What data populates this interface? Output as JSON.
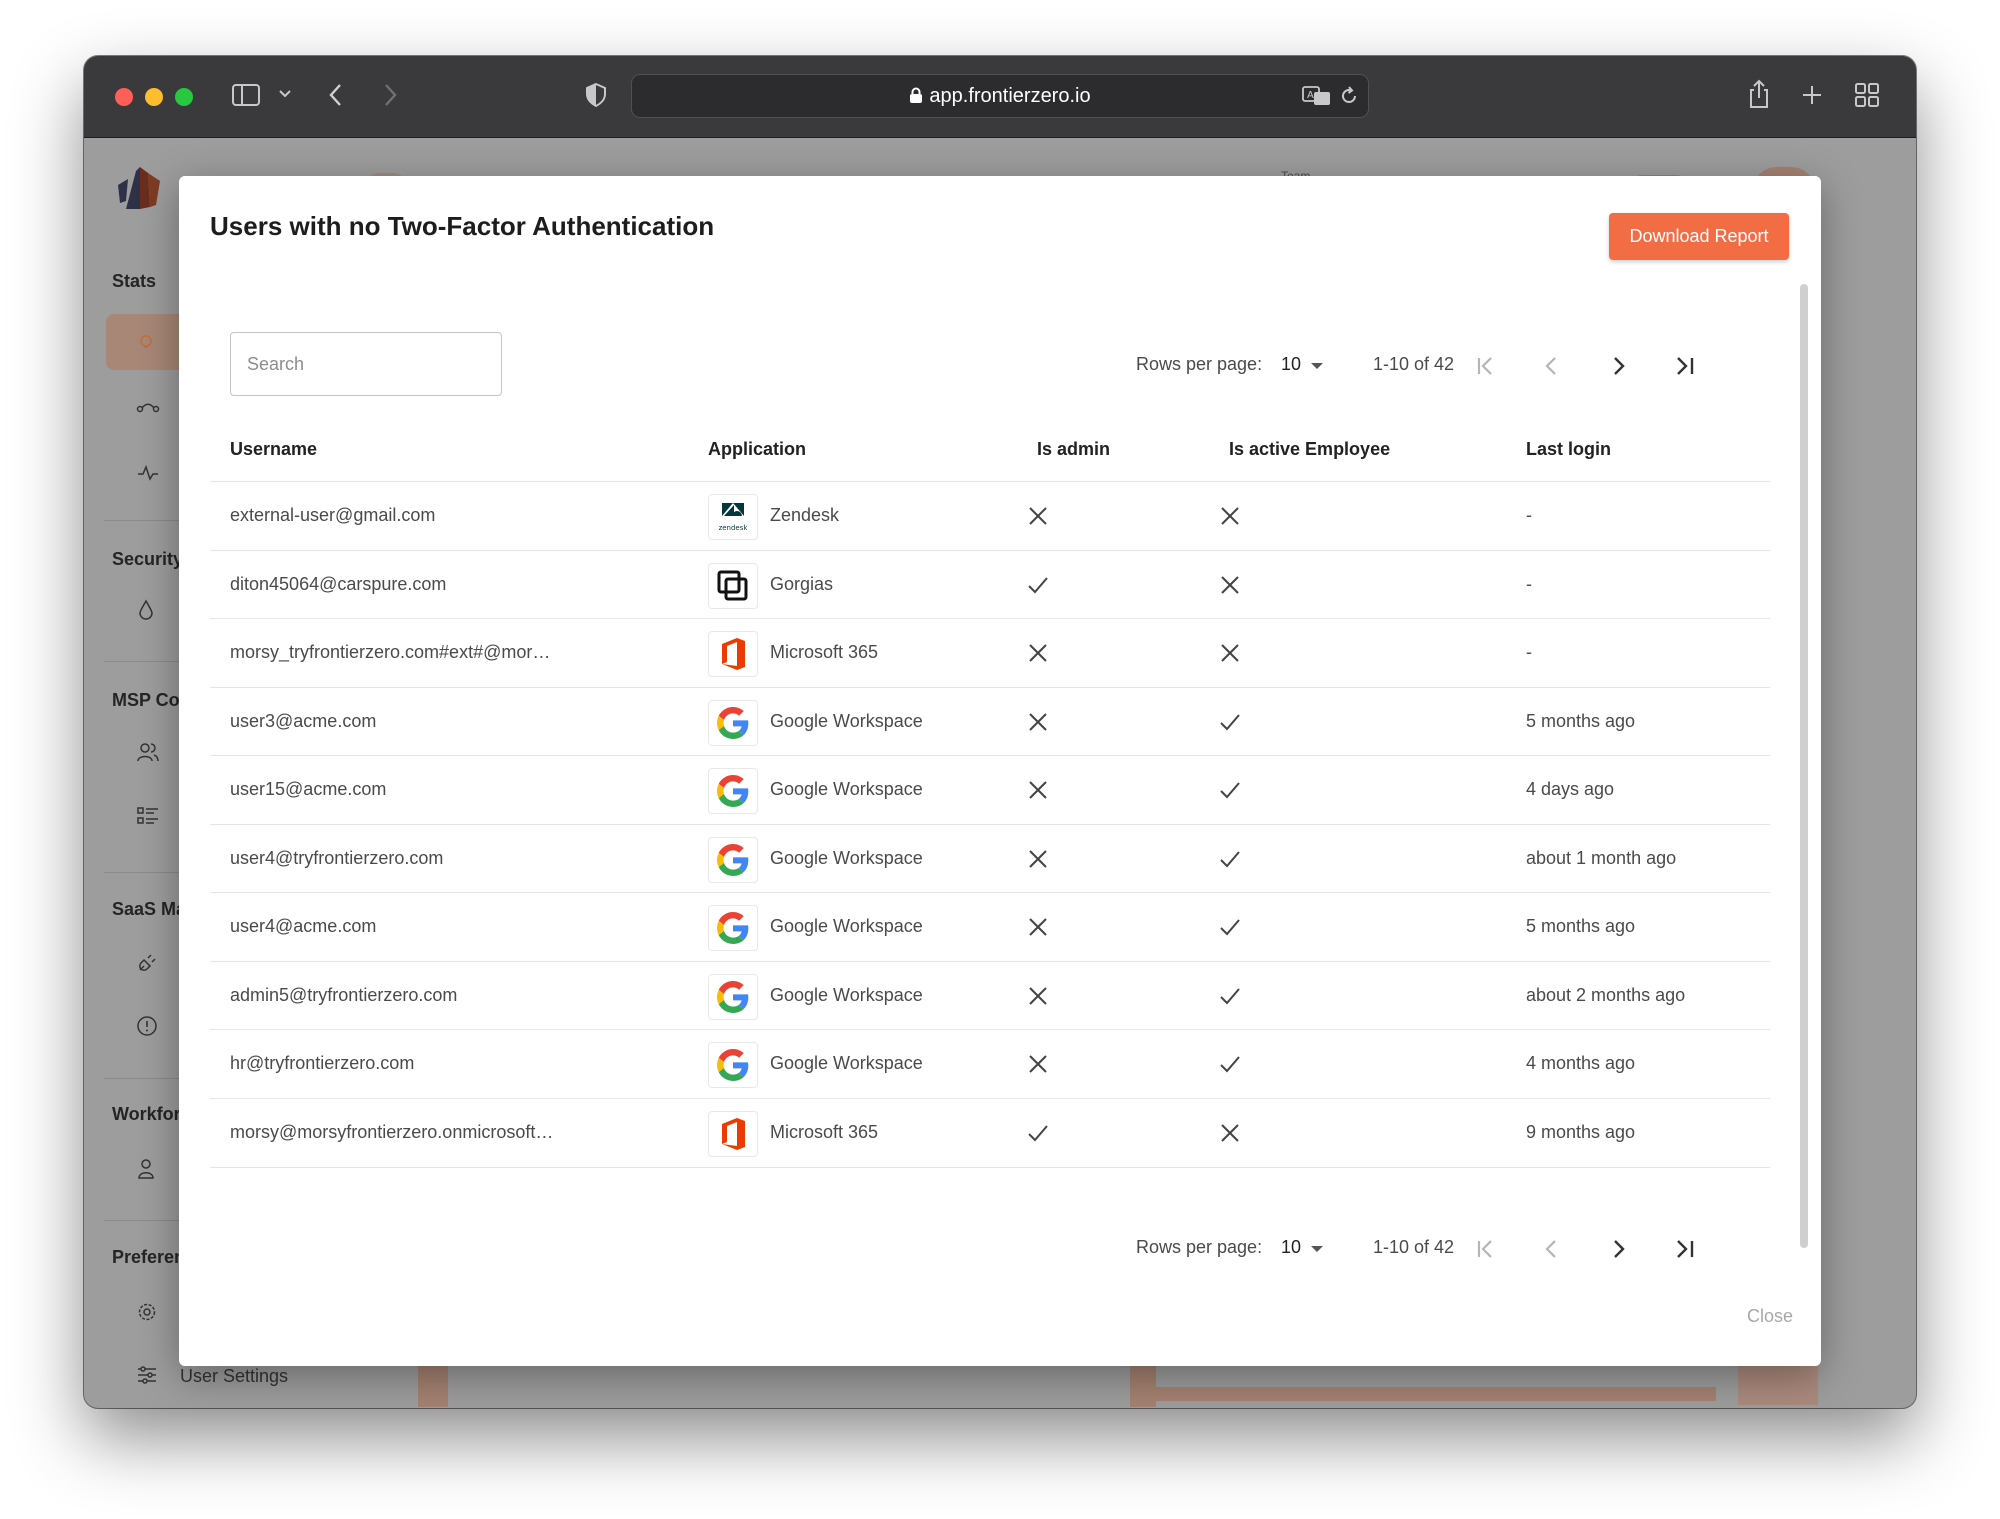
{
  "browser": {
    "url": "app.frontierzero.io"
  },
  "app": {
    "header": {
      "team_label": "Team"
    },
    "sidebar": {
      "sections": [
        "Stats",
        "Security",
        "MSP Co",
        "SaaS Ma",
        "Workfor",
        "Preferen"
      ],
      "footer_item": "User Settings"
    }
  },
  "modal": {
    "title": "Users with no Two-Factor Authentication",
    "download_button": "Download Report",
    "search_placeholder": "Search",
    "pagination": {
      "rows_per_page_label": "Rows per page:",
      "rows_per_page_value": "10",
      "range": "1-10 of 42"
    },
    "columns": {
      "username": "Username",
      "application": "Application",
      "is_admin": "Is admin",
      "is_active": "Is active Employee",
      "last_login": "Last login"
    },
    "rows": [
      {
        "username": "external-user@gmail.com",
        "app": "Zendesk",
        "app_icon": "zendesk-logo",
        "is_admin": false,
        "is_active": false,
        "last_login": "-"
      },
      {
        "username": "diton45064@carspure.com",
        "app": "Gorgias",
        "app_icon": "gorgias-logo",
        "is_admin": true,
        "is_active": false,
        "last_login": "-"
      },
      {
        "username": "morsy_tryfrontierzero.com#ext#@mor…",
        "app": "Microsoft 365",
        "app_icon": "microsoft-365-logo",
        "is_admin": false,
        "is_active": false,
        "last_login": "-"
      },
      {
        "username": "user3@acme.com",
        "app": "Google Workspace",
        "app_icon": "google-logo",
        "is_admin": false,
        "is_active": true,
        "last_login": "5 months ago"
      },
      {
        "username": "user15@acme.com",
        "app": "Google Workspace",
        "app_icon": "google-logo",
        "is_admin": false,
        "is_active": true,
        "last_login": "4 days ago"
      },
      {
        "username": "user4@tryfrontierzero.com",
        "app": "Google Workspace",
        "app_icon": "google-logo",
        "is_admin": false,
        "is_active": true,
        "last_login": "about 1 month ago"
      },
      {
        "username": "user4@acme.com",
        "app": "Google Workspace",
        "app_icon": "google-logo",
        "is_admin": false,
        "is_active": true,
        "last_login": "5 months ago"
      },
      {
        "username": "admin5@tryfrontierzero.com",
        "app": "Google Workspace",
        "app_icon": "google-logo",
        "is_admin": false,
        "is_active": true,
        "last_login": "about 2 months ago"
      },
      {
        "username": "hr@tryfrontierzero.com",
        "app": "Google Workspace",
        "app_icon": "google-logo",
        "is_admin": false,
        "is_active": true,
        "last_login": "4 months ago"
      },
      {
        "username": "morsy@morsyfrontierzero.onmicrosoft…",
        "app": "Microsoft 365",
        "app_icon": "microsoft-365-logo",
        "is_admin": true,
        "is_active": false,
        "last_login": "9 months ago"
      }
    ],
    "close_label": "Close"
  },
  "colors": {
    "accent": "#f26d43",
    "titlebar": "#3a3a3c",
    "overlay": "#9d9d9d"
  }
}
